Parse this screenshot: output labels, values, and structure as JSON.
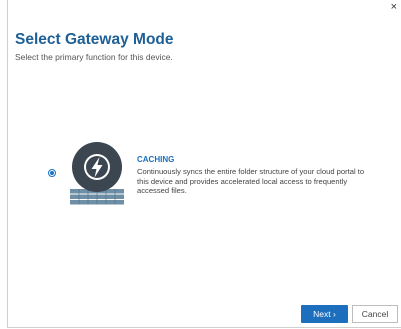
{
  "dialog": {
    "close_glyph": "×",
    "title": "Select Gateway Mode",
    "subtitle": "Select the primary function for this device."
  },
  "options": [
    {
      "label": "CACHING",
      "description": "Continuously syncs the entire folder structure of your cloud portal to this device and provides accelerated local access to frequently accessed files.",
      "selected": true,
      "icon": "lightning-bolt-server-icon"
    }
  ],
  "buttons": {
    "next_label": "Next",
    "next_glyph": "›",
    "cancel_label": "Cancel"
  },
  "colors": {
    "title": "#1e5f96",
    "accent": "#1d6fbe",
    "icon_circle": "#3b4650",
    "server_stack": "#6e8fa6"
  }
}
